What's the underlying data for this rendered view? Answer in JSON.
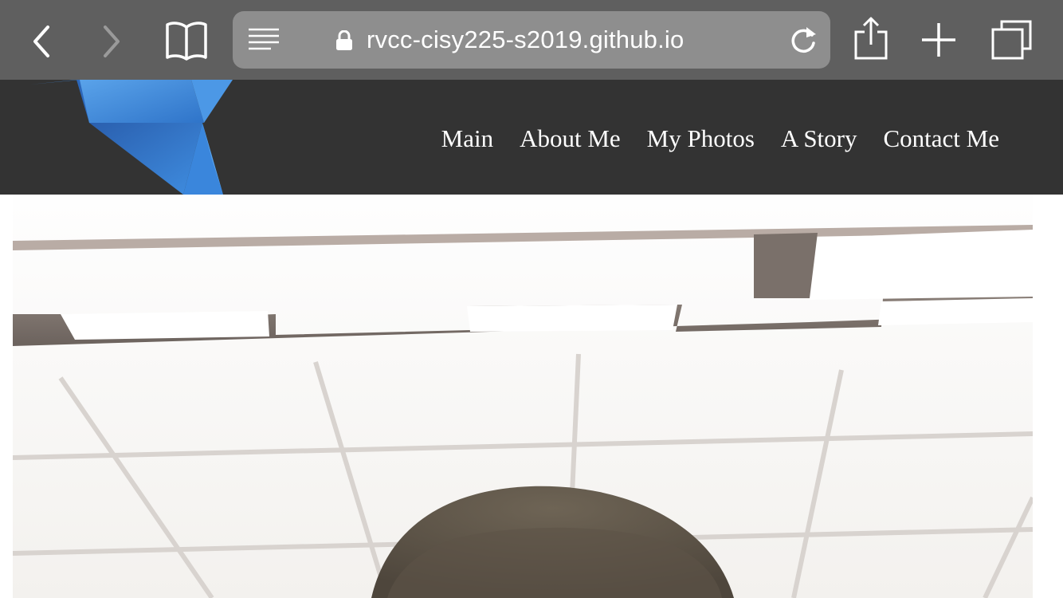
{
  "browser": {
    "url": "rvcc-cisy225-s2019.github.io",
    "icons": [
      "back-icon",
      "forward-icon",
      "bookmarks-icon",
      "reader-icon",
      "lock-icon",
      "reload-icon",
      "share-icon",
      "new-tab-icon",
      "tabs-icon"
    ]
  },
  "nav": {
    "items": [
      {
        "label": "Main"
      },
      {
        "label": "About Me"
      },
      {
        "label": "My Photos"
      },
      {
        "label": "A Story"
      },
      {
        "label": "Contact Me"
      }
    ]
  },
  "colors": {
    "toolbar": "#5f5f5f",
    "urlbar": "#8e8e8e",
    "header": "#333333",
    "logo_blue": "#3d84d6"
  }
}
